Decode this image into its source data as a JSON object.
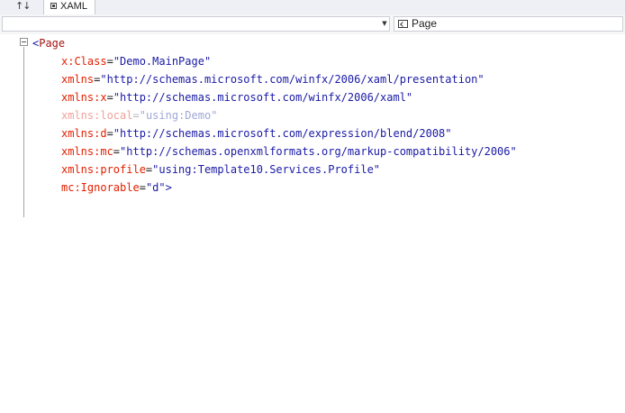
{
  "tabs": {
    "swap_label": "↑↓",
    "xaml_label": "XAML"
  },
  "navigation": {
    "left_combo_value": "",
    "right_combo_value": "Page"
  },
  "code": {
    "open_bracket": "<",
    "tag": "Page",
    "close_bracket": ">",
    "attributes": [
      {
        "name": "x:Class",
        "value": "\"Demo.MainPage\"",
        "dimmed": false
      },
      {
        "name": "xmlns",
        "value": "\"http://schemas.microsoft.com/winfx/2006/xaml/presentation\"",
        "dimmed": false
      },
      {
        "name": "xmlns:x",
        "value": "\"http://schemas.microsoft.com/winfx/2006/xaml\"",
        "dimmed": false
      },
      {
        "name": "xmlns:local",
        "value": "\"using:Demo\"",
        "dimmed": true
      },
      {
        "name": "xmlns:d",
        "value": "\"http://schemas.microsoft.com/expression/blend/2008\"",
        "dimmed": false
      },
      {
        "name": "xmlns:mc",
        "value": "\"http://schemas.openxmlformats.org/markup-compatibility/2006\"",
        "dimmed": false
      },
      {
        "name": "xmlns:profile",
        "value": "\"using:Template10.Services.Profile\"",
        "dimmed": false
      },
      {
        "name": "mc:Ignorable",
        "value": "\"d\"",
        "dimmed": false
      }
    ]
  },
  "colors": {
    "tag": "#a31515",
    "attribute": "#e21f00",
    "value": "#1a1aa6",
    "dimmed_attribute": "#f0a29a",
    "dimmed_value": "#a0a8d8"
  }
}
